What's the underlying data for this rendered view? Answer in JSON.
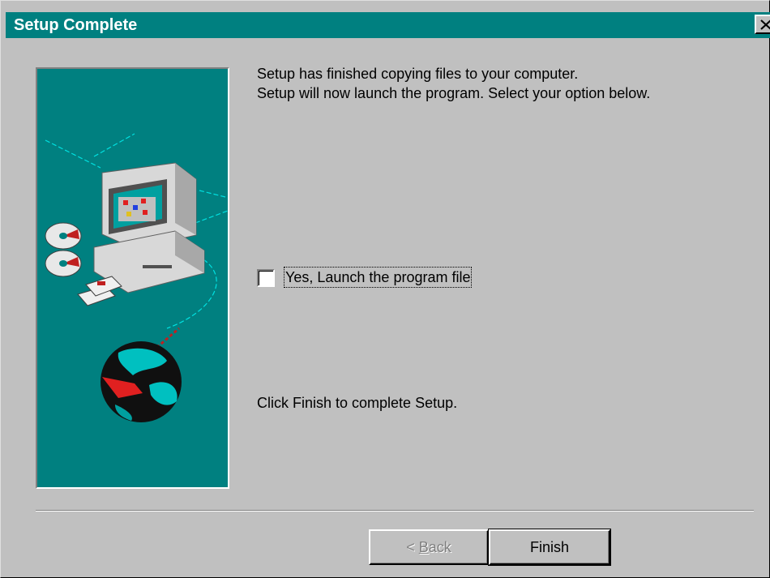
{
  "window": {
    "title": "Setup Complete"
  },
  "message": {
    "line1": "Setup has finished copying files to your computer.",
    "line2": "Setup will now launch the program. Select your option below."
  },
  "option": {
    "label": "Yes, Launch the program file",
    "checked": false
  },
  "finish_message": "Click Finish to complete Setup.",
  "buttons": {
    "back_label": "< Back",
    "back_enabled": false,
    "finish_label": "Finish"
  },
  "colors": {
    "titlebar": "#008080",
    "dialog_bg": "#c0c0c0",
    "panel_bg": "#008080"
  },
  "icons": [
    "close-icon",
    "computer-icon",
    "cd-icon",
    "floppy-disk-icon",
    "globe-icon"
  ]
}
